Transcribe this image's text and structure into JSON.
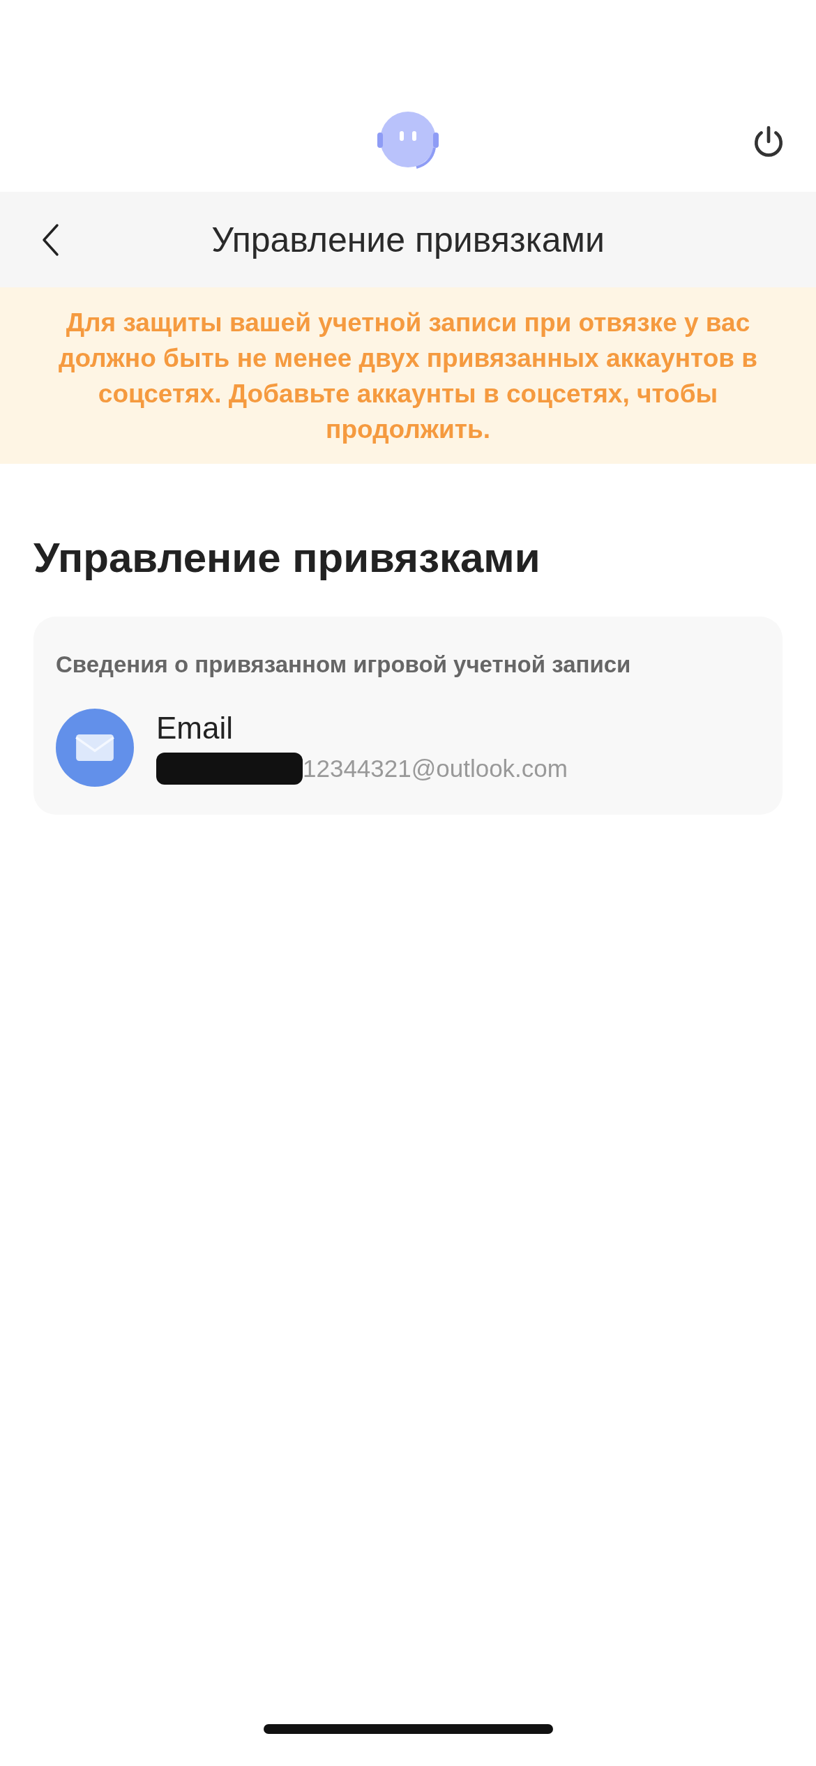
{
  "nav_bar": {
    "title": "Управление привязками"
  },
  "warning_banner": {
    "text": "Для защиты вашей учетной записи при отвязке у вас должно быть не менее двух привязанных аккаунтов в соцсетях. Добавьте аккаунты в соцсетях, чтобы продолжить."
  },
  "heading": "Управление привязками",
  "card": {
    "title": "Сведения о привязанном игровой учетной записи",
    "accounts": [
      {
        "kind": "email",
        "name": "Email",
        "address": "12344321@outlook.com",
        "redacted": true
      }
    ]
  }
}
